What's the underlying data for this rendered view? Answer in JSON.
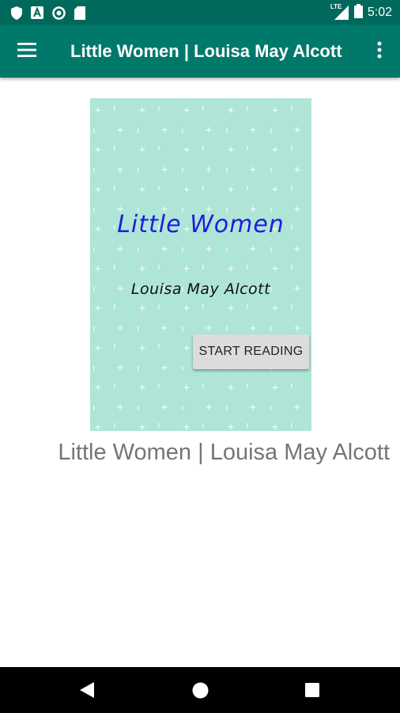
{
  "status_bar": {
    "time": "5:02",
    "network": "LTE",
    "icons": [
      "shield-icon",
      "a-box-icon",
      "circle-icon",
      "sd-card-icon",
      "signal-icon",
      "battery-icon"
    ]
  },
  "app_bar": {
    "title": "Little Women | Louisa May Alcott",
    "menu_icon": "hamburger-menu-icon",
    "overflow_icon": "more-vert-icon",
    "color": "#00796b"
  },
  "cover": {
    "title": "Little Women",
    "author": "Louisa May Alcott",
    "button_label": "START READING",
    "background": "#aee5d7"
  },
  "book_title": "Little Women | Louisa May Alcott",
  "nav_bar": {
    "icons": [
      "back-icon",
      "home-icon",
      "recents-icon"
    ]
  }
}
